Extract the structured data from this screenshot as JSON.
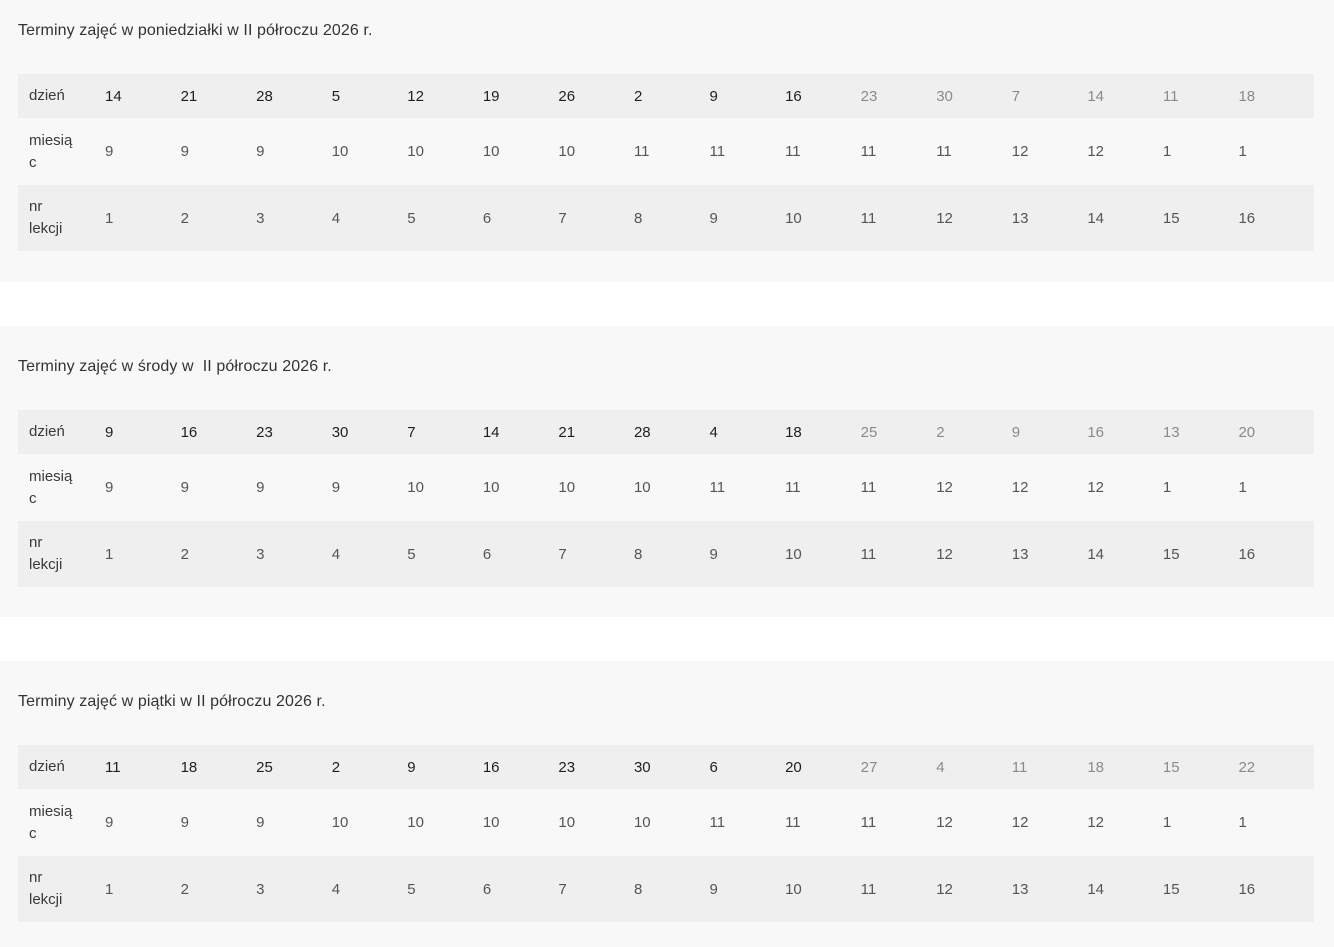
{
  "row_labels": {
    "day": "dzień",
    "month": "miesią\nc",
    "lesson": "nr\nlekcji"
  },
  "sections": [
    {
      "title": "Terminy zajęć w poniedziałki w II półroczu 2026 r.",
      "days": [
        "14",
        "21",
        "28",
        "5",
        "12",
        "19",
        "26",
        "2",
        "9",
        "16",
        "23",
        "30",
        "7",
        "14",
        "11",
        "18"
      ],
      "months": [
        "9",
        "9",
        "9",
        "10",
        "10",
        "10",
        "10",
        "11",
        "11",
        "11",
        "11",
        "11",
        "12",
        "12",
        "1",
        "1"
      ],
      "lessons": [
        "1",
        "2",
        "3",
        "4",
        "5",
        "6",
        "7",
        "8",
        "9",
        "10",
        "11",
        "12",
        "13",
        "14",
        "15",
        "16"
      ]
    },
    {
      "title": "Terminy zajęć w środy w  II półroczu 2026 r.",
      "days": [
        "9",
        "16",
        "23",
        "30",
        "7",
        "14",
        "21",
        "28",
        "4",
        "18",
        "25",
        "2",
        "9",
        "16",
        "13",
        "20"
      ],
      "months": [
        "9",
        "9",
        "9",
        "9",
        "10",
        "10",
        "10",
        "10",
        "11",
        "11",
        "11",
        "12",
        "12",
        "12",
        "1",
        "1"
      ],
      "lessons": [
        "1",
        "2",
        "3",
        "4",
        "5",
        "6",
        "7",
        "8",
        "9",
        "10",
        "11",
        "12",
        "13",
        "14",
        "15",
        "16"
      ]
    },
    {
      "title": "Terminy zajęć w piątki w II półroczu 2026 r.",
      "days": [
        "11",
        "18",
        "25",
        "2",
        "9",
        "16",
        "23",
        "30",
        "6",
        "20",
        "27",
        "4",
        "11",
        "18",
        "15",
        "22"
      ],
      "months": [
        "9",
        "9",
        "9",
        "10",
        "10",
        "10",
        "10",
        "10",
        "11",
        "11",
        "11",
        "12",
        "12",
        "12",
        "1",
        "1"
      ],
      "lessons": [
        "1",
        "2",
        "3",
        "4",
        "5",
        "6",
        "7",
        "8",
        "9",
        "10",
        "11",
        "12",
        "13",
        "14",
        "15",
        "16"
      ]
    }
  ]
}
